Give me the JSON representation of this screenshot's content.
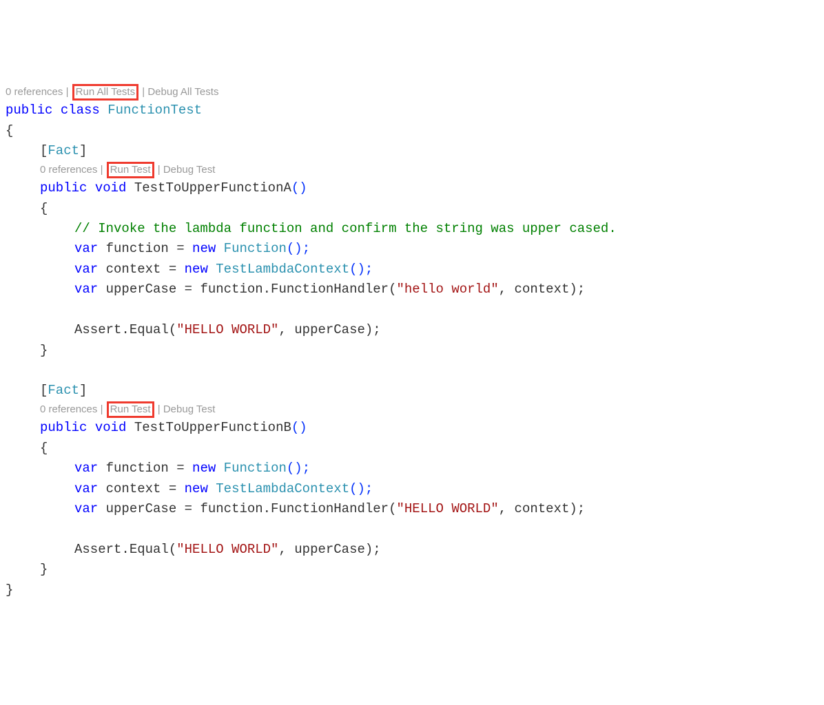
{
  "classCodelens": {
    "references": "0 references",
    "runAll": "Run All Tests",
    "debugAll": "Debug All Tests"
  },
  "classDecl": {
    "kw_public": "public",
    "kw_class": "class",
    "name": "FunctionTest"
  },
  "brace_open": "{",
  "brace_close": "}",
  "testA": {
    "attribute": "[Fact]",
    "codelens": {
      "references": "0 references",
      "run": "Run Test",
      "debug": "Debug Test"
    },
    "sig": {
      "kw_public": "public",
      "kw_void": "void",
      "name": "TestToUpperFunctionA",
      "parens": "()"
    },
    "comment": "// Invoke the lambda function and confirm the string was upper cased.",
    "line1": {
      "kw_var": "var",
      "name": " function = ",
      "kw_new": "new",
      "type": " Function",
      "call": "();"
    },
    "line2": {
      "kw_var": "var",
      "name": " context = ",
      "kw_new": "new",
      "type": " TestLambdaContext",
      "call": "();"
    },
    "line3": {
      "kw_var": "var",
      "pre": " upperCase = function.FunctionHandler(",
      "str": "\"hello world\"",
      "post": ", context);"
    },
    "assert": {
      "pre": "Assert.Equal(",
      "str": "\"HELLO WORLD\"",
      "post": ", upperCase);"
    }
  },
  "testB": {
    "attribute": "[Fact]",
    "codelens": {
      "references": "0 references",
      "run": "Run Test",
      "debug": "Debug Test"
    },
    "sig": {
      "kw_public": "public",
      "kw_void": "void",
      "name": "TestToUpperFunctionB",
      "parens": "()"
    },
    "line1": {
      "kw_var": "var",
      "name": " function = ",
      "kw_new": "new",
      "type": " Function",
      "call": "();"
    },
    "line2": {
      "kw_var": "var",
      "name": " context = ",
      "kw_new": "new",
      "type": " TestLambdaContext",
      "call": "();"
    },
    "line3": {
      "kw_var": "var",
      "pre": " upperCase = function.FunctionHandler(",
      "str": "\"HELLO WORLD\"",
      "post": ", context);"
    },
    "assert": {
      "pre": "Assert.Equal(",
      "str": "\"HELLO WORLD\"",
      "post": ", upperCase);"
    }
  }
}
